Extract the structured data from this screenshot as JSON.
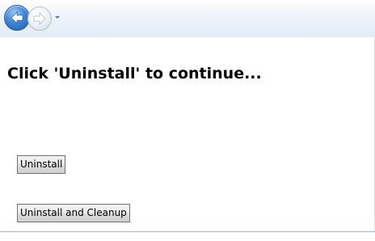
{
  "navigation": {
    "back_icon": "back-arrow-icon",
    "forward_icon": "forward-arrow-icon",
    "dropdown_icon": "dropdown-arrow-icon"
  },
  "main": {
    "title": "Click 'Uninstall' to continue...",
    "uninstall_label": "Uninstall",
    "uninstall_cleanup_label": "Uninstall and Cleanup"
  },
  "colors": {
    "back_button": "#3f86d6",
    "navbar": "#e3ebf6",
    "background": "#ffffff"
  }
}
